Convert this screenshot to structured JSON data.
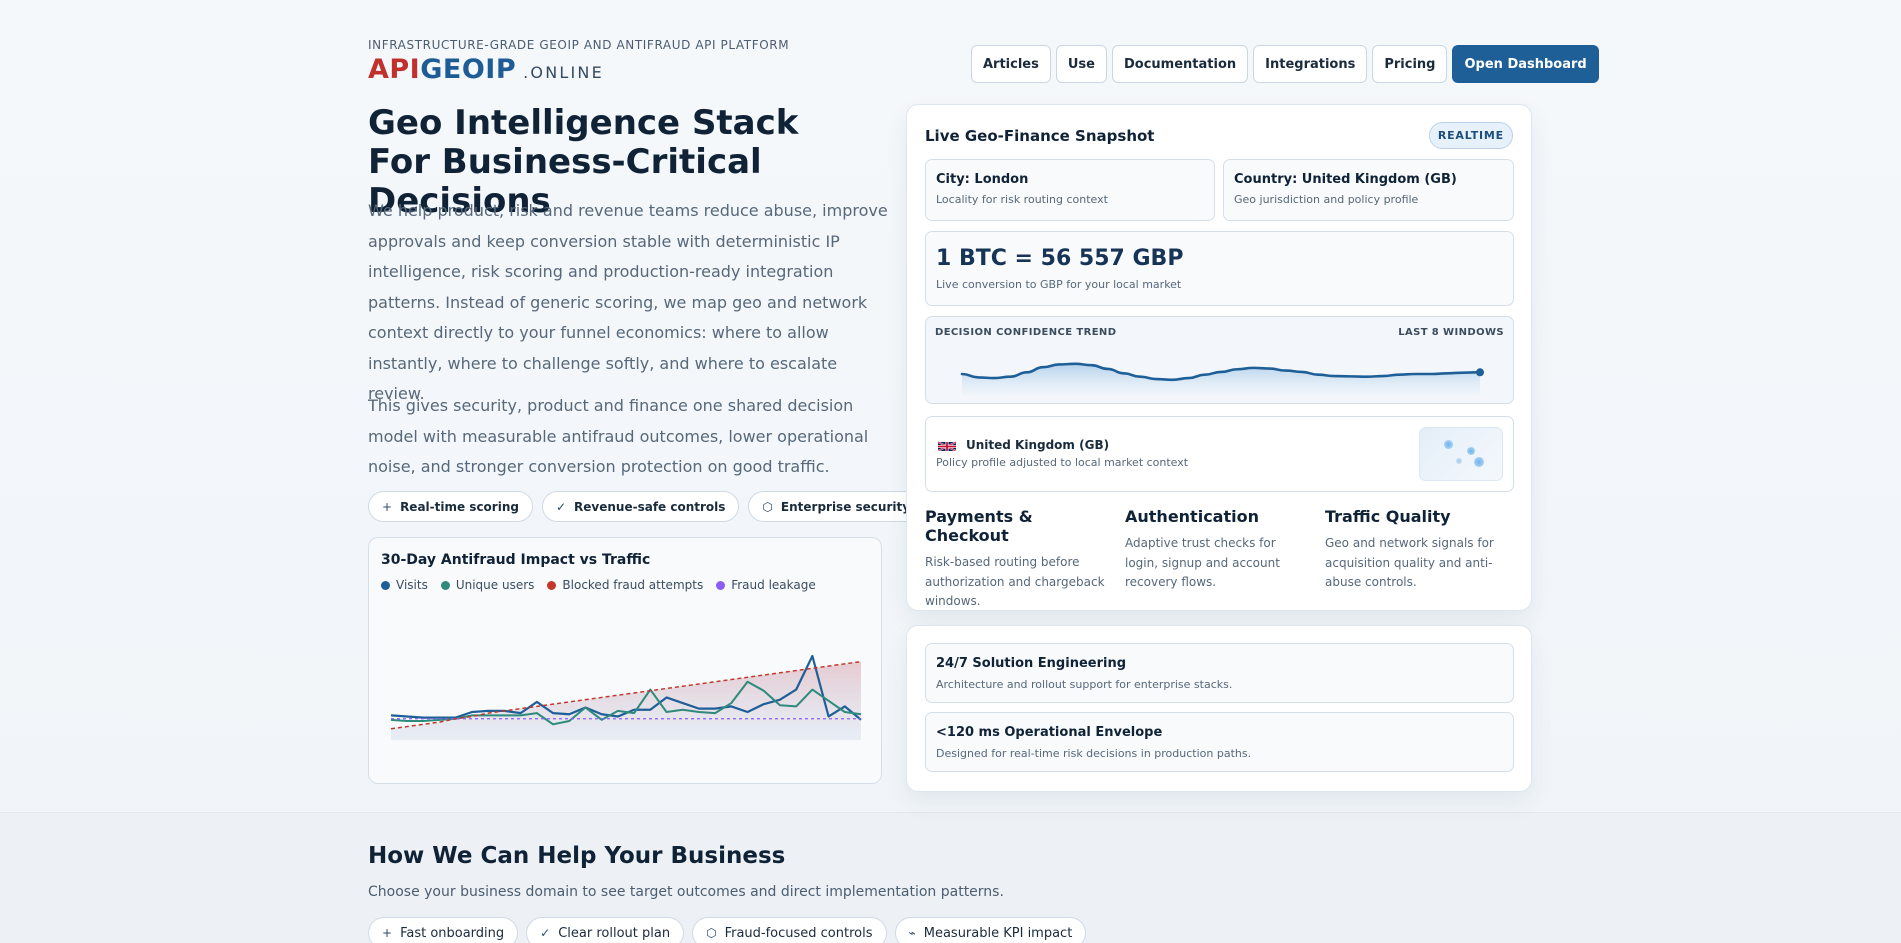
{
  "header": {
    "eyebrow": "INFRASTRUCTURE-GRADE GEOIP AND ANTIFRAUD API PLATFORM",
    "logo": {
      "part1": "API",
      "part2": "GEOIP",
      "part3": ".ONLINE"
    },
    "nav": [
      "Articles",
      "Use",
      "Documentation",
      "Integrations",
      "Pricing"
    ],
    "cta": "Open Dashboard"
  },
  "hero": {
    "title": "Geo Intelligence Stack For Business-Critical Decisions",
    "paragraph1": "We help product, risk and revenue teams reduce abuse, improve approvals and keep conversion stable with deterministic IP intelligence, risk scoring and production-ready integration patterns. Instead of generic scoring, we map geo and network context directly to your funnel economics: where to allow instantly, where to challenge softly, and where to escalate review.",
    "paragraph2": "This gives security, product and finance one shared decision model with measurable antifraud outcomes, lower operational noise, and stronger conversion protection on good traffic.",
    "chips": [
      {
        "icon": "plus-icon",
        "glyph": "+",
        "label": "Real-time scoring"
      },
      {
        "icon": "check-icon",
        "glyph": "✓",
        "label": "Revenue-safe controls"
      },
      {
        "icon": "shield-icon",
        "glyph": "⬡",
        "label": "Enterprise security"
      }
    ]
  },
  "impact_chart": {
    "title": "30-Day Antifraud Impact vs Traffic",
    "legend": [
      {
        "name": "Visits",
        "color": "#1f5f97"
      },
      {
        "name": "Unique users",
        "color": "#2e8a7a"
      },
      {
        "name": "Blocked fraud attempts",
        "color": "#c0392b"
      },
      {
        "name": "Fraud leakage",
        "color": "#8b5cf6"
      }
    ]
  },
  "chart_data": [
    {
      "type": "line",
      "title": "30-Day Antifraud Impact vs Traffic",
      "x": [
        1,
        2,
        3,
        4,
        5,
        6,
        7,
        8,
        9,
        10,
        11,
        12,
        13,
        14,
        15,
        16,
        17,
        18,
        19,
        20,
        21,
        22,
        23,
        24,
        25,
        26,
        27,
        28,
        29,
        30
      ],
      "ylim": [
        0,
        100
      ],
      "series": [
        {
          "name": "Visits",
          "color": "#1f5f97",
          "values": [
            22,
            21,
            20,
            20,
            20,
            25,
            26,
            26,
            24,
            34,
            24,
            23,
            29,
            23,
            21,
            27,
            27,
            38,
            33,
            28,
            28,
            30,
            25,
            32,
            36,
            45,
            75,
            21,
            30,
            18
          ]
        },
        {
          "name": "Unique users",
          "color": "#2e8a7a",
          "values": [
            18,
            17,
            17,
            18,
            19,
            22,
            22,
            22,
            22,
            24,
            14,
            17,
            29,
            18,
            26,
            24,
            45,
            25,
            27,
            25,
            24,
            33,
            52,
            44,
            31,
            30,
            45,
            35,
            25,
            23
          ]
        },
        {
          "name": "Blocked fraud attempts",
          "color": "#c0392b",
          "values": [
            10,
            12,
            14,
            16,
            19,
            21,
            24,
            26,
            28,
            30,
            32,
            34,
            36,
            38,
            40,
            42,
            44,
            46,
            48,
            50,
            52,
            54,
            56,
            58,
            60,
            62,
            64,
            66,
            68,
            70
          ]
        },
        {
          "name": "Fraud leakage",
          "color": "#8b5cf6",
          "values": [
            19,
            19,
            19,
            19,
            19,
            19,
            19,
            19,
            19,
            19,
            19,
            19,
            19,
            19,
            19,
            19,
            19,
            19,
            19,
            19,
            19,
            19,
            19,
            19,
            19,
            19,
            19,
            19,
            19,
            19
          ]
        }
      ]
    },
    {
      "type": "area",
      "title": "DECISION CONFIDENCE TREND",
      "x": [
        1,
        2,
        3,
        4,
        5,
        6,
        7,
        8,
        9,
        10,
        11,
        12,
        13,
        14,
        15,
        16,
        17,
        18,
        19,
        20,
        21,
        22,
        23,
        24,
        25,
        26,
        27,
        28,
        29,
        30,
        31,
        32,
        33
      ],
      "ylim": [
        0,
        100
      ],
      "series": [
        {
          "name": "",
          "color": "#1f5f97",
          "values": [
            50,
            40,
            38,
            42,
            55,
            70,
            78,
            80,
            76,
            65,
            52,
            42,
            35,
            33,
            38,
            48,
            56,
            64,
            68,
            66,
            60,
            56,
            48,
            44,
            43,
            42,
            44,
            48,
            50,
            50,
            52,
            54,
            55
          ]
        }
      ]
    }
  ],
  "snapshot": {
    "title": "Live Geo-Finance Snapshot",
    "badge": "REALTIME",
    "city": {
      "title": "City: London",
      "subtitle": "Locality for risk routing context"
    },
    "country": {
      "title": "Country: United Kingdom (GB)",
      "subtitle": "Geo jurisdiction and policy profile"
    },
    "rate": {
      "value": "1 BTC = 56 557 GBP",
      "subtitle": "Live conversion to GBP for your local market"
    },
    "trend": {
      "label": "DECISION CONFIDENCE TREND",
      "window": "LAST 8 WINDOWS"
    },
    "region": {
      "name": "United Kingdom (GB)",
      "subtitle": "Policy profile adjusted to local market context"
    },
    "features": [
      {
        "title": "Payments & Checkout",
        "text": "Risk-based routing before authorization and chargeback windows."
      },
      {
        "title": "Authentication",
        "text": "Adaptive trust checks for login, signup and account recovery flows."
      },
      {
        "title": "Traffic Quality",
        "text": "Geo and network signals for acquisition quality and anti-abuse controls."
      }
    ]
  },
  "support": [
    {
      "title": "24/7 Solution Engineering",
      "text": "Architecture and rollout support for enterprise stacks."
    },
    {
      "title": "<120 ms Operational Envelope",
      "text": "Designed for real-time risk decisions in production paths."
    }
  ],
  "help": {
    "title": "How We Can Help Your Business",
    "subtitle": "Choose your business domain to see target outcomes and direct implementation patterns.",
    "chips": [
      {
        "icon": "plus-icon",
        "glyph": "+",
        "label": "Fast onboarding"
      },
      {
        "icon": "check-icon",
        "glyph": "✓",
        "label": "Clear rollout plan"
      },
      {
        "icon": "shield-icon",
        "glyph": "⬡",
        "label": "Fraud-focused controls"
      },
      {
        "icon": "chart-icon",
        "glyph": "⌁",
        "label": "Measurable KPI impact"
      }
    ]
  }
}
